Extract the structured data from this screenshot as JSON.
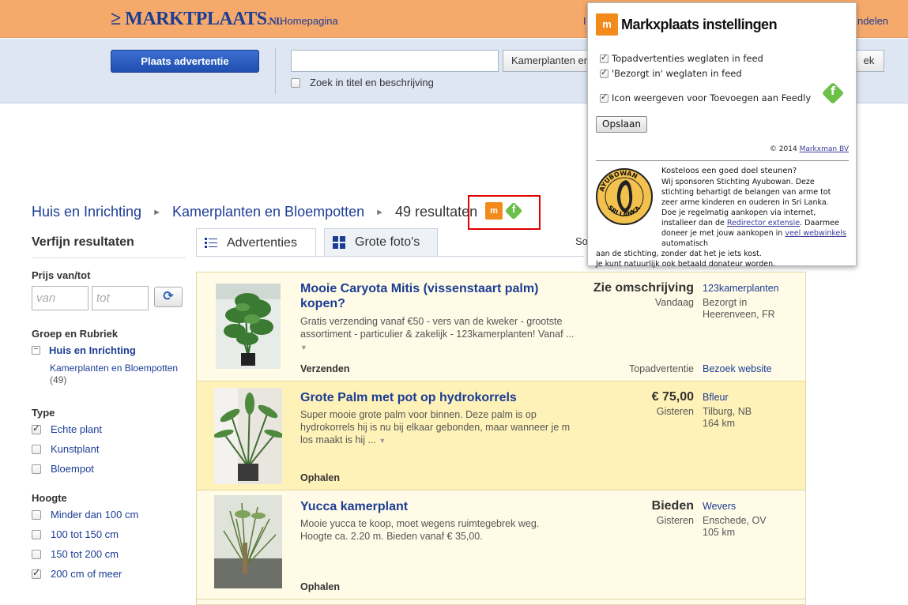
{
  "header": {
    "logo_main": "MARKTPLAATS",
    "logo_suffix": ".NL",
    "home_link": "Homepagina",
    "right_partial_1": "I",
    "right_partial_2": "ndelen"
  },
  "search": {
    "post_button": "Plaats advertentie",
    "query_value": "",
    "category_selected": "Kamerplanten en",
    "search_button": "ek",
    "title_desc_label": "Zoek in titel en beschrijving"
  },
  "breadcrumb": {
    "level1": "Huis en Inrichting",
    "level2": "Kamerplanten en Bloempotten",
    "count": "49 resultaten",
    "separator": "►"
  },
  "icons": {
    "markxplaats": "markxplaats-icon",
    "feedly": "feedly-icon",
    "mm_glyph": "m"
  },
  "sidebar": {
    "title": "Verfijn resultaten",
    "price_label": "Prijs van/tot",
    "price_from_placeholder": "van",
    "price_to_placeholder": "tot",
    "refresh_glyph": "⟳",
    "group_label": "Groep en Rubriek",
    "group_main": "Huis en Inrichting",
    "group_sub": "Kamerplanten en Bloempotten",
    "group_sub_count": "(49)",
    "type_label": "Type",
    "types": [
      {
        "label": "Echte plant",
        "checked": true
      },
      {
        "label": "Kunstplant",
        "checked": false
      },
      {
        "label": "Bloempot",
        "checked": false
      }
    ],
    "height_label": "Hoogte",
    "heights": [
      {
        "label": "Minder dan 100 cm",
        "checked": false
      },
      {
        "label": "100 tot 150 cm",
        "checked": false
      },
      {
        "label": "150 tot 200 cm",
        "checked": false
      },
      {
        "label": "200 cm of meer",
        "checked": true
      }
    ]
  },
  "tabs": {
    "ads": "Advertenties",
    "photos": "Grote foto's",
    "sort_partial": "So"
  },
  "listings": [
    {
      "title": "Mooie Caryota Mitis (vissenstaart palm) kopen?",
      "description": "Gratis verzending vanaf €50 - vers van de kweker - grootste assortiment - particulier & zakelijk - 123kamerplanten! Vanaf ...",
      "delivery": "Verzenden",
      "price": "Zie omschrijving",
      "date": "Vandaag",
      "seller": "123kamerplanten",
      "location": "Bezorgt in Heerenveen, FR",
      "badge": "Topadvertentie",
      "visit": "Bezoek website"
    },
    {
      "title": "Grote Palm met pot op hydrokorrels",
      "description": "Super mooie grote palm voor binnen.  Deze palm is op hydrokorrels   hij is nu bij elkaar gebonden, maar wanneer je m los maakt is hij ...",
      "delivery": "Ophalen",
      "price": "€ 75,00",
      "date": "Gisteren",
      "seller": "Bfleur",
      "location": "Tilburg, NB",
      "distance": "164 km"
    },
    {
      "title": "Yucca kamerplant",
      "description": "Mooie yucca te koop, moet wegens ruimtegebrek weg. Hoogte ca. 2.20 m. Bieden vanaf € 35,00.",
      "delivery": "Ophalen",
      "price": "Bieden",
      "date": "Gisteren",
      "seller": "Wevers",
      "location": "Enschede, OV",
      "distance": "105 km"
    }
  ],
  "popup": {
    "title": "Markxplaats instellingen",
    "options": [
      {
        "label": "Topadvertenties weglaten in feed",
        "checked": true
      },
      {
        "label": "'Bezorgt in' weglaten in feed",
        "checked": true
      },
      {
        "label": "Icon weergeven voor Toevoegen aan Feedly",
        "checked": true
      }
    ],
    "save_button": "Opslaan",
    "copyright": "© 2014",
    "copyright_link": "Markxman BV",
    "seal_top": "AYUBOWAN",
    "seal_bottom": "SRI LANKA",
    "charity_title": "Kosteloos een goed doel steunen?",
    "charity_l1": "Wij sponsoren Stichting Ayubowan. Deze",
    "charity_l2": "stichting behartigt de belangen van arme tot",
    "charity_l3": "zeer arme kinderen en ouderen in Sri Lanka.",
    "charity_l4": "Doe je regelmatig aankopen via internet,",
    "charity_l5a": "installeer dan de",
    "charity_l5_link": "Redirector extensie",
    "charity_l5b": ". Daarmee",
    "charity_l6a": "doneer je met jouw aankopen in",
    "charity_l6_link": "veel webwinkels",
    "charity_l6b": "automatisch",
    "charity_l7": "aan de stichting, zonder dat het je iets kost.",
    "charity_l8": "Je kunt natuurlijk ook betaald donateur worden."
  },
  "colors": {
    "topbar": "#f5a96b",
    "brand_blue": "#1b3d94",
    "search_band": "#dde6f2",
    "listing_alt": "#fff2b8",
    "highlight_box": "#e00000"
  }
}
